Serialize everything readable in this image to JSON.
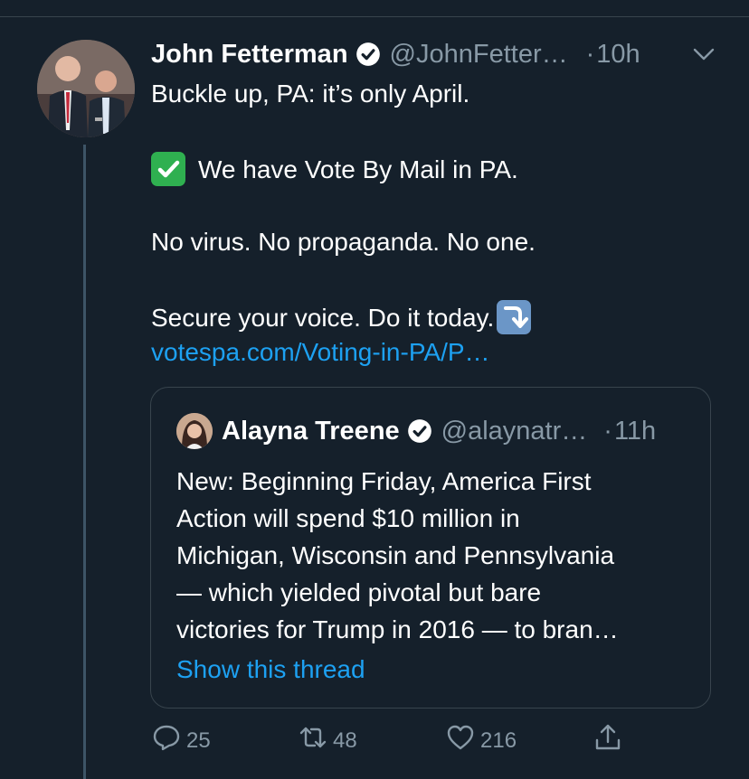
{
  "tweet": {
    "author_name": "John Fetterman",
    "author_handle": "@JohnFetter…",
    "dot": "·",
    "time": "10h",
    "lines": [
      "Buckle up, PA:  it’s only April.",
      "We have Vote By Mail in PA.",
      "No virus. No propaganda. No one.",
      "Secure your voice. Do it today."
    ],
    "link": "votespa.com/Voting-in-PA/P…"
  },
  "quote": {
    "author_name": "Alayna Treene",
    "author_handle": "@alaynatr…",
    "dot": "·",
    "time": "11h",
    "lines": [
      "New: Beginning Friday, America First",
      "Action will spend $10 million in",
      "Michigan, Wisconsin and Pennsylvania",
      "— which yielded pivotal but bare",
      "victories for Trump in 2016 — to bran…"
    ],
    "show_thread": "Show this thread"
  },
  "actions": {
    "replies": "25",
    "retweets": "48",
    "likes": "216"
  },
  "icons": {
    "verified": "verified-badge-icon",
    "check": "check-mark-emoji-icon",
    "arrow": "arrow-down-right-emoji-icon",
    "reply": "reply-icon",
    "retweet": "retweet-icon",
    "like": "heart-icon",
    "share": "share-icon",
    "chevron": "chevron-down-icon"
  },
  "colors": {
    "background": "#15202b",
    "link": "#1da1f2",
    "secondary_text": "#8899a6",
    "border": "#38444d"
  }
}
